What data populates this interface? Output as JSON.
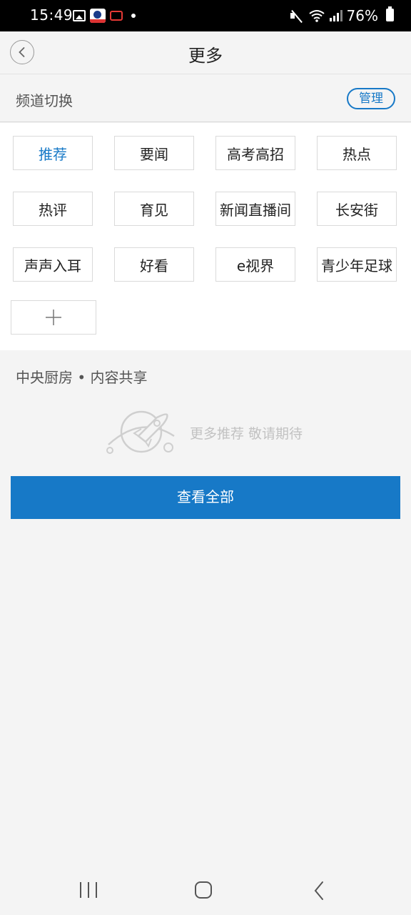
{
  "status_bar": {
    "time": "15:49",
    "battery": "76%",
    "icons": [
      "gallery-icon",
      "app-icon",
      "screen-record-icon",
      "dot-icon",
      "mute-icon",
      "wifi-icon",
      "signal-icon",
      "battery-icon"
    ]
  },
  "header": {
    "title": "更多",
    "back_icon": "chevron-left-icon"
  },
  "channel_switch": {
    "label": "频道切换",
    "manage_label": "管理"
  },
  "channels": [
    {
      "label": "推荐",
      "active": true
    },
    {
      "label": "要闻",
      "active": false
    },
    {
      "label": "高考高招",
      "active": false
    },
    {
      "label": "热点",
      "active": false
    },
    {
      "label": "热评",
      "active": false
    },
    {
      "label": "育见",
      "active": false
    },
    {
      "label": "新闻直播间",
      "active": false
    },
    {
      "label": "长安街",
      "active": false
    },
    {
      "label": "声声入耳",
      "active": false
    },
    {
      "label": "好看",
      "active": false
    },
    {
      "label": "e视界",
      "active": false
    },
    {
      "label": "青少年足球",
      "active": false
    }
  ],
  "add_channel_icon": "plus-icon",
  "shared": {
    "title": "中央厨房 • 内容共享",
    "empty_text": "更多推荐 敬请期待",
    "empty_icon": "rocket-planet-icon",
    "view_all_label": "查看全部"
  },
  "colors": {
    "accent": "#1779c7",
    "background": "#f4f4f4",
    "status_bar": "#000000"
  },
  "nav_bar": {
    "icons": [
      "recent-apps-icon",
      "home-icon",
      "back-icon"
    ]
  }
}
